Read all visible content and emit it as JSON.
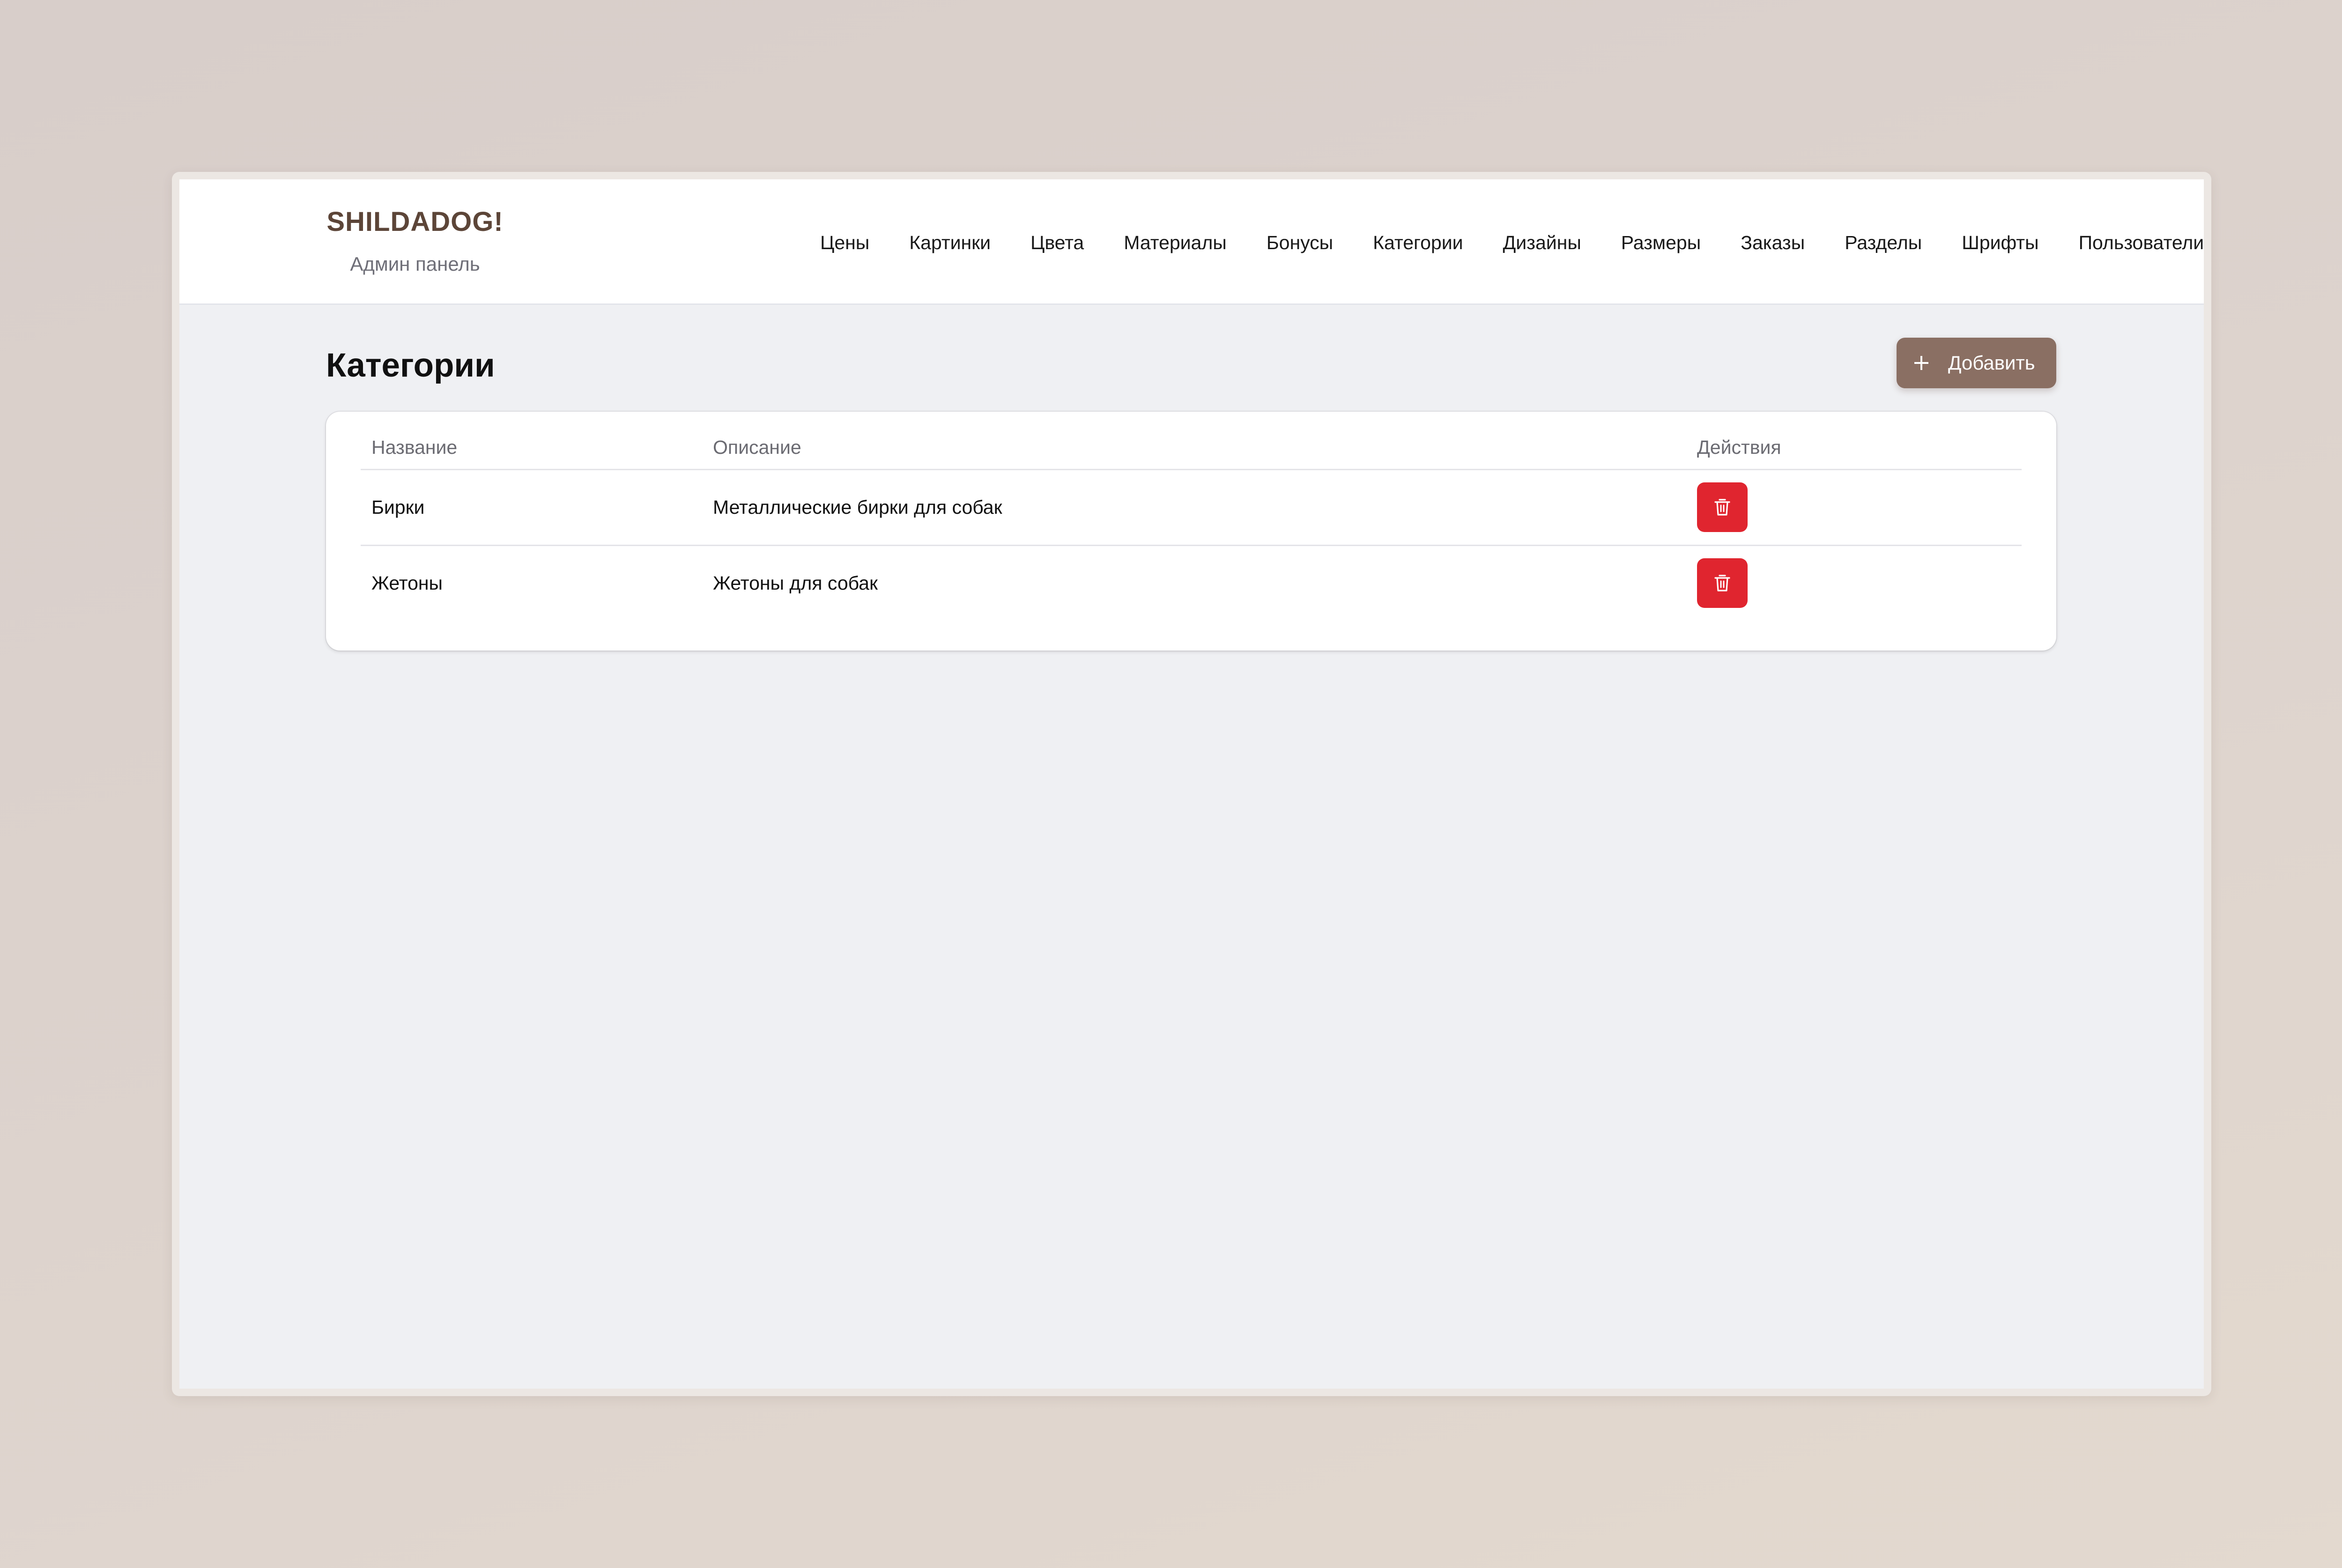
{
  "header": {
    "brand": "SHILDADOG!",
    "subtitle": "Админ панель",
    "nav": [
      {
        "label": "Цены",
        "key": "prices"
      },
      {
        "label": "Картинки",
        "key": "images"
      },
      {
        "label": "Цвета",
        "key": "colors"
      },
      {
        "label": "Материалы",
        "key": "materials"
      },
      {
        "label": "Бонусы",
        "key": "bonuses"
      },
      {
        "label": "Категории",
        "key": "categories"
      },
      {
        "label": "Дизайны",
        "key": "designs"
      },
      {
        "label": "Размеры",
        "key": "sizes"
      },
      {
        "label": "Заказы",
        "key": "orders"
      },
      {
        "label": "Разделы",
        "key": "sections"
      },
      {
        "label": "Шрифты",
        "key": "fonts"
      },
      {
        "label": "Пользователи",
        "key": "users"
      }
    ]
  },
  "main": {
    "title": "Категории",
    "add_button_label": "Добавить",
    "add_button_icon": "plus-icon",
    "table": {
      "columns": [
        "Название",
        "Описание",
        "Действия"
      ],
      "rows": [
        {
          "name": "Бирки",
          "description": "Металлические бирки для собак",
          "action_icon": "trash-icon"
        },
        {
          "name": "Жетоны",
          "description": "Жетоны для собак",
          "action_icon": "trash-icon"
        }
      ]
    }
  },
  "colors": {
    "brand": "#5c4538",
    "accent_button": "#8a6f63",
    "danger": "#e0252f",
    "page_background": "#eff0f3"
  }
}
